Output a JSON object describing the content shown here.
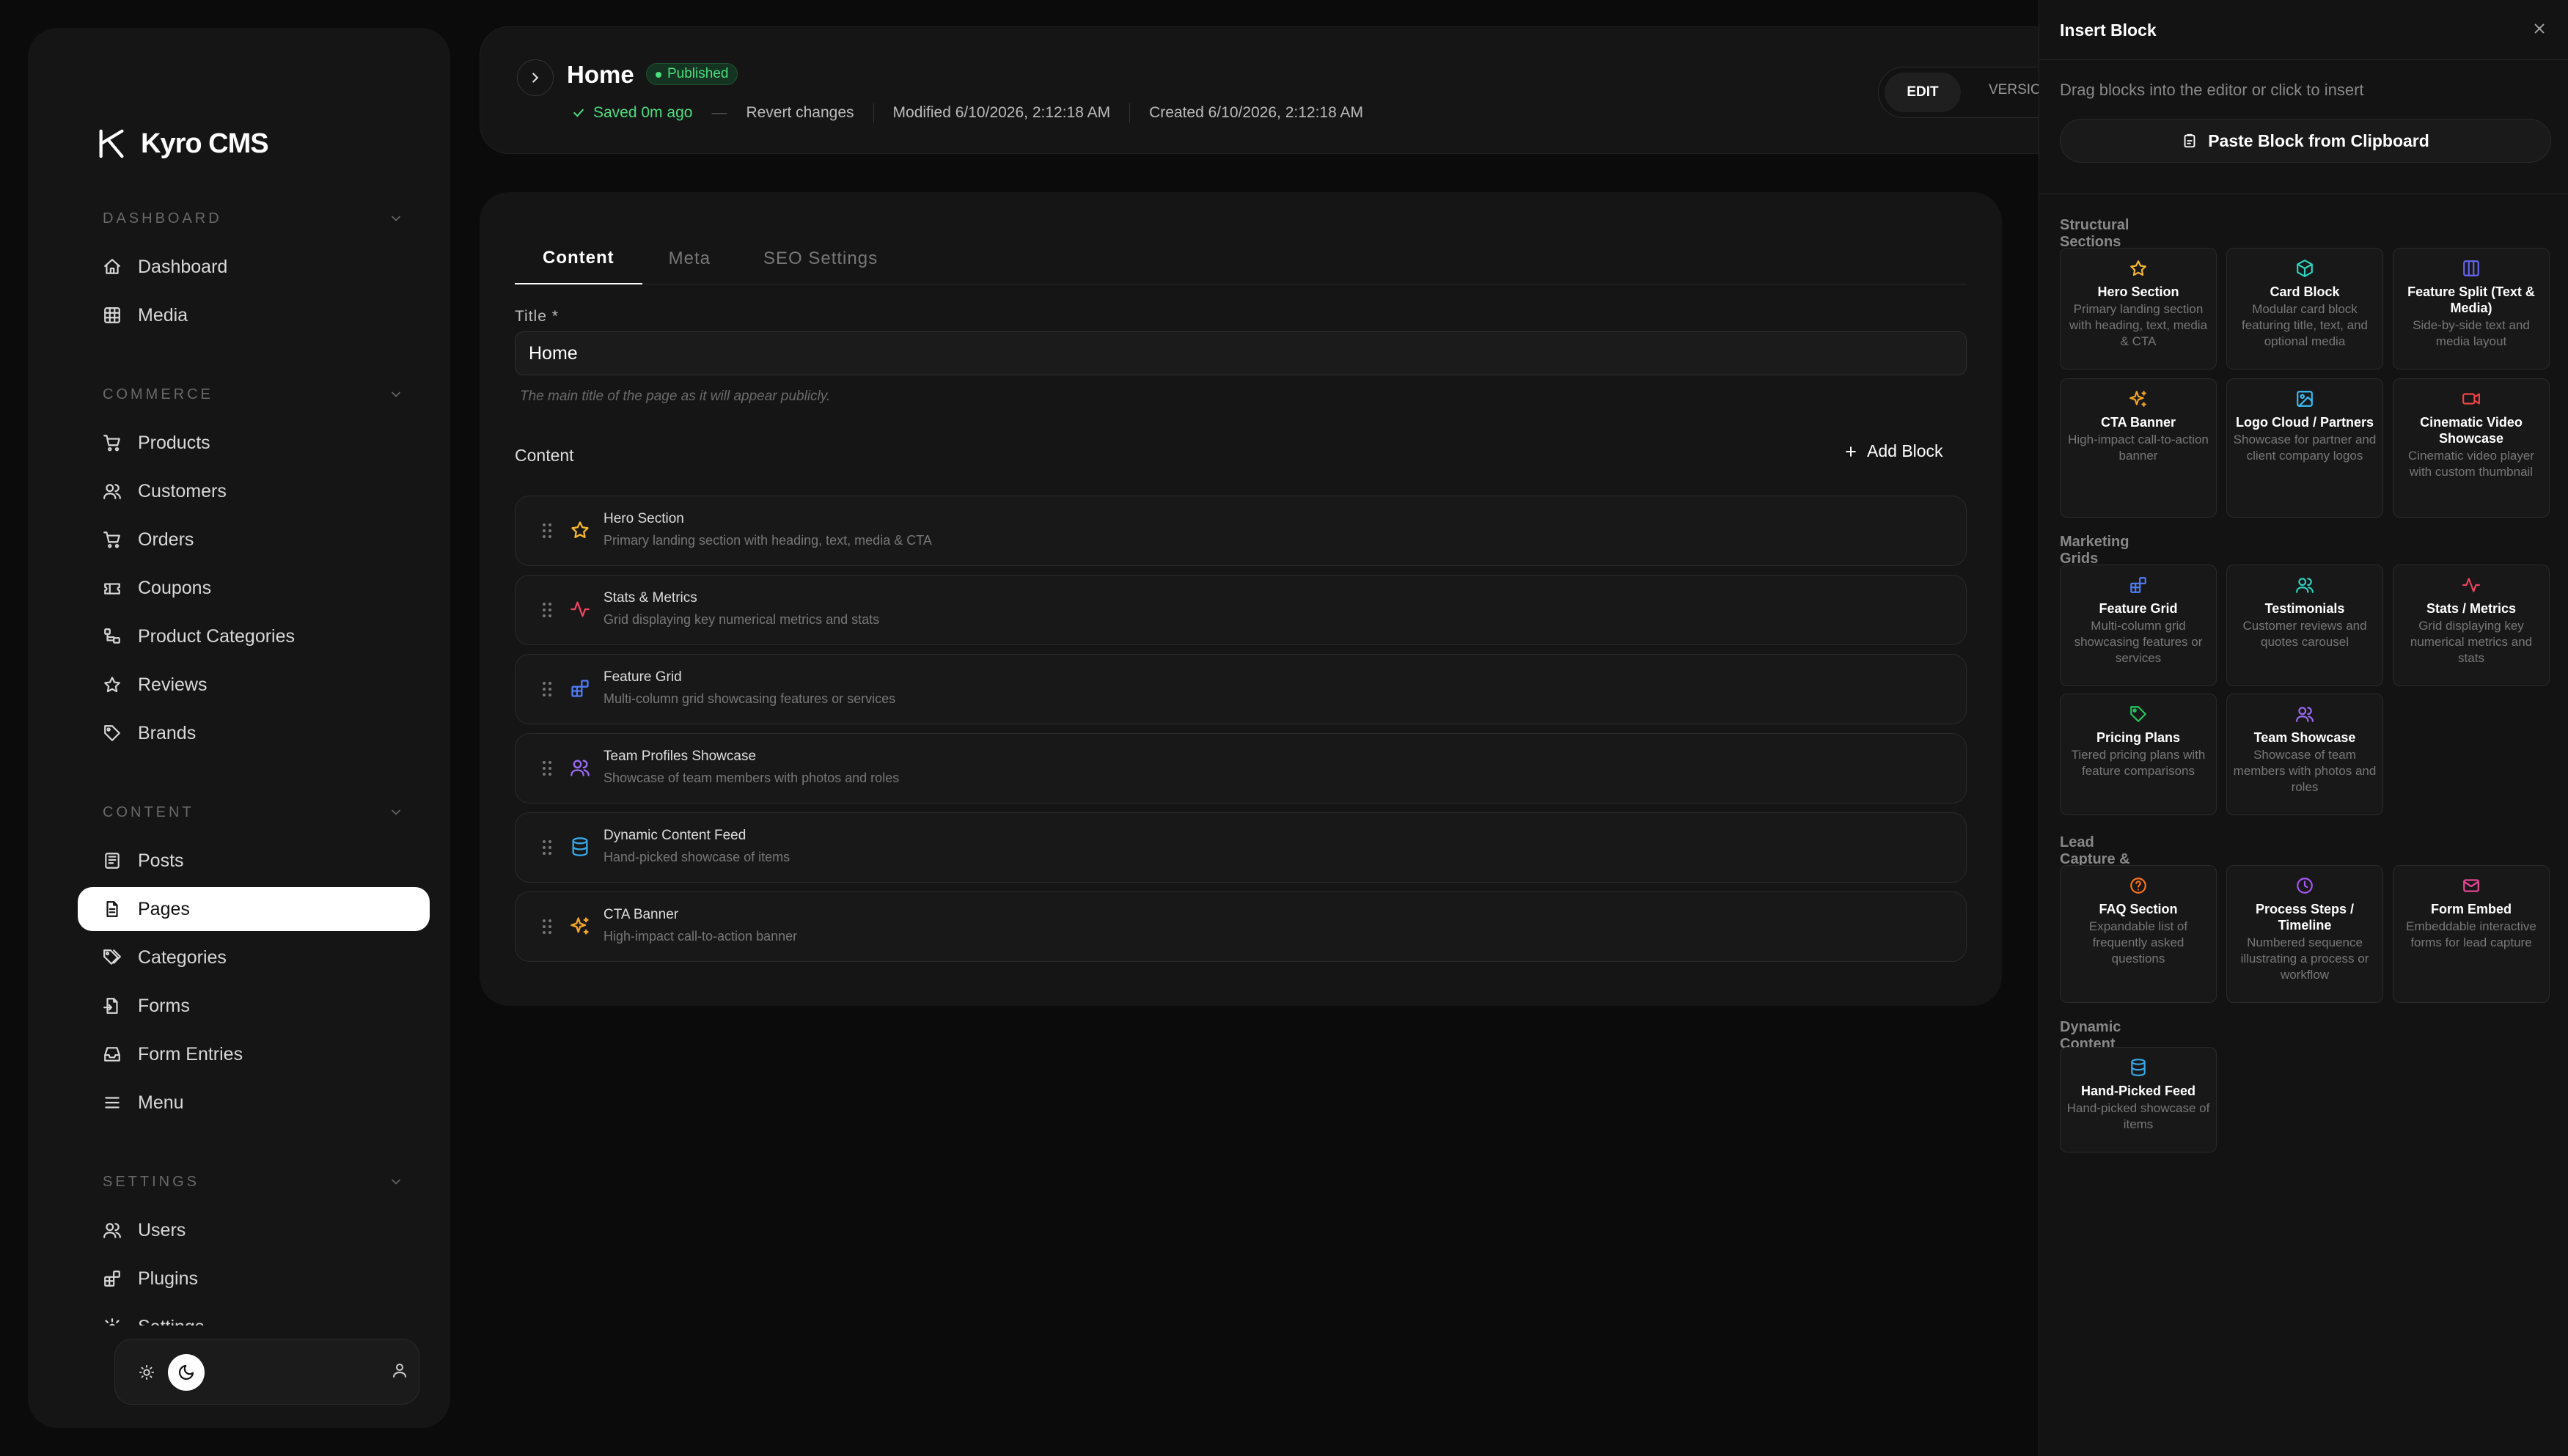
{
  "app": {
    "name": "Kyro CMS"
  },
  "sidebar": {
    "sections": [
      {
        "label": "DASHBOARD",
        "items": [
          {
            "label": "Dashboard",
            "icon": "home-icon"
          },
          {
            "label": "Media",
            "icon": "grid-icon"
          }
        ]
      },
      {
        "label": "COMMERCE",
        "items": [
          {
            "label": "Products",
            "icon": "cart-icon"
          },
          {
            "label": "Customers",
            "icon": "users-icon"
          },
          {
            "label": "Orders",
            "icon": "cart-icon"
          },
          {
            "label": "Coupons",
            "icon": "ticket-icon"
          },
          {
            "label": "Product Categories",
            "icon": "tree-icon"
          },
          {
            "label": "Reviews",
            "icon": "star-icon"
          },
          {
            "label": "Brands",
            "icon": "tag-icon"
          }
        ]
      },
      {
        "label": "CONTENT",
        "items": [
          {
            "label": "Posts",
            "icon": "newspaper-icon"
          },
          {
            "label": "Pages",
            "icon": "file-icon",
            "active": true
          },
          {
            "label": "Categories",
            "icon": "tags-icon"
          },
          {
            "label": "Forms",
            "icon": "file-input-icon"
          },
          {
            "label": "Form Entries",
            "icon": "inbox-icon"
          },
          {
            "label": "Menu",
            "icon": "menu-icon"
          }
        ]
      },
      {
        "label": "SETTINGS",
        "items": [
          {
            "label": "Users",
            "icon": "users-icon"
          },
          {
            "label": "Plugins",
            "icon": "blocks-icon"
          },
          {
            "label": "Settings",
            "icon": "gear-icon"
          }
        ]
      }
    ]
  },
  "header": {
    "title": "Home",
    "status": "Published",
    "saved": "Saved 0m ago",
    "revert": "Revert changes",
    "modified": "Modified 6/10/2026, 2:12:18 AM",
    "created": "Created 6/10/2026, 2:12:18 AM",
    "mode_edit": "EDIT",
    "mode_version": "VERSION"
  },
  "editor": {
    "tabs": [
      "Content",
      "Meta",
      "SEO Settings"
    ],
    "title_label": "Title *",
    "title_value": "Home",
    "title_help": "The main title of the page as it will appear publicly.",
    "content_label": "Content",
    "add_block": "Add Block",
    "blocks": [
      {
        "name": "Hero Section",
        "desc": "Primary landing section with heading, text, media & CTA",
        "icon": "star-icon",
        "color": "#f5b82e"
      },
      {
        "name": "Stats & Metrics",
        "desc": "Grid displaying key numerical metrics and stats",
        "icon": "activity-icon",
        "color": "#ef4461"
      },
      {
        "name": "Feature Grid",
        "desc": "Multi-column grid showcasing features or services",
        "icon": "blocks-icon",
        "color": "#4f7cf5"
      },
      {
        "name": "Team Profiles Showcase",
        "desc": "Showcase of team members with photos and roles",
        "icon": "users-icon",
        "color": "#9b6cf5"
      },
      {
        "name": "Dynamic Content Feed",
        "desc": "Hand-picked showcase of items",
        "icon": "database-icon",
        "color": "#38a8e8"
      },
      {
        "name": "CTA Banner",
        "desc": "High-impact call-to-action banner",
        "icon": "sparkles-icon",
        "color": "#f5a623"
      }
    ]
  },
  "panel": {
    "title": "Insert Block",
    "subtitle": "Drag blocks into the editor or click to insert",
    "paste": "Paste Block from Clipboard",
    "categories": [
      {
        "label": "Structural Sections",
        "items": [
          {
            "name": "Hero Section",
            "desc": "Primary landing section with heading, text, media & CTA",
            "icon": "star-icon",
            "color": "#f5b82e"
          },
          {
            "name": "Card Block",
            "desc": "Modular card block featuring title, text, and optional media",
            "icon": "box-icon",
            "color": "#2dd4bf"
          },
          {
            "name": "Feature Split (Text & Media)",
            "desc": "Side-by-side text and media layout",
            "icon": "columns-icon",
            "color": "#6366f1"
          },
          {
            "name": "CTA Banner",
            "desc": "High-impact call-to-action banner",
            "icon": "sparkles-icon",
            "color": "#f5a623"
          },
          {
            "name": "Logo Cloud / Partners",
            "desc": "Showcase for partner and client company logos",
            "icon": "image-icon",
            "color": "#38bdf8"
          },
          {
            "name": "Cinematic Video Showcase",
            "desc": "Cinematic video player with custom thumbnail",
            "icon": "video-icon",
            "color": "#ef4444"
          }
        ]
      },
      {
        "label": "Marketing Grids",
        "items": [
          {
            "name": "Feature Grid",
            "desc": "Multi-column grid showcasing features or services",
            "icon": "blocks-icon",
            "color": "#4f7cf5"
          },
          {
            "name": "Testimonials",
            "desc": "Customer reviews and quotes carousel",
            "icon": "users-icon",
            "color": "#2dd4bf"
          },
          {
            "name": "Stats / Metrics",
            "desc": "Grid displaying key numerical metrics and stats",
            "icon": "activity-icon",
            "color": "#ef4461"
          },
          {
            "name": "Pricing Plans",
            "desc": "Tiered pricing plans with feature comparisons",
            "icon": "tag-icon",
            "color": "#22c55e"
          },
          {
            "name": "Team Showcase",
            "desc": "Showcase of team members with photos and roles",
            "icon": "users-icon",
            "color": "#9b6cf5"
          }
        ]
      },
      {
        "label": "Lead Capture & Interactive",
        "items": [
          {
            "name": "FAQ Section",
            "desc": "Expandable list of frequently asked questions",
            "icon": "help-circle-icon",
            "color": "#f97316"
          },
          {
            "name": "Process Steps / Timeline",
            "desc": "Numbered sequence illustrating a process or workflow",
            "icon": "clock-icon",
            "color": "#a855f7"
          },
          {
            "name": "Form Embed",
            "desc": "Embeddable interactive forms for lead capture",
            "icon": "mail-icon",
            "color": "#ec4899"
          }
        ]
      },
      {
        "label": "Dynamic Content",
        "items": [
          {
            "name": "Hand-Picked Feed",
            "desc": "Hand-picked showcase of items",
            "icon": "database-icon",
            "color": "#38a8e8"
          }
        ]
      }
    ]
  }
}
